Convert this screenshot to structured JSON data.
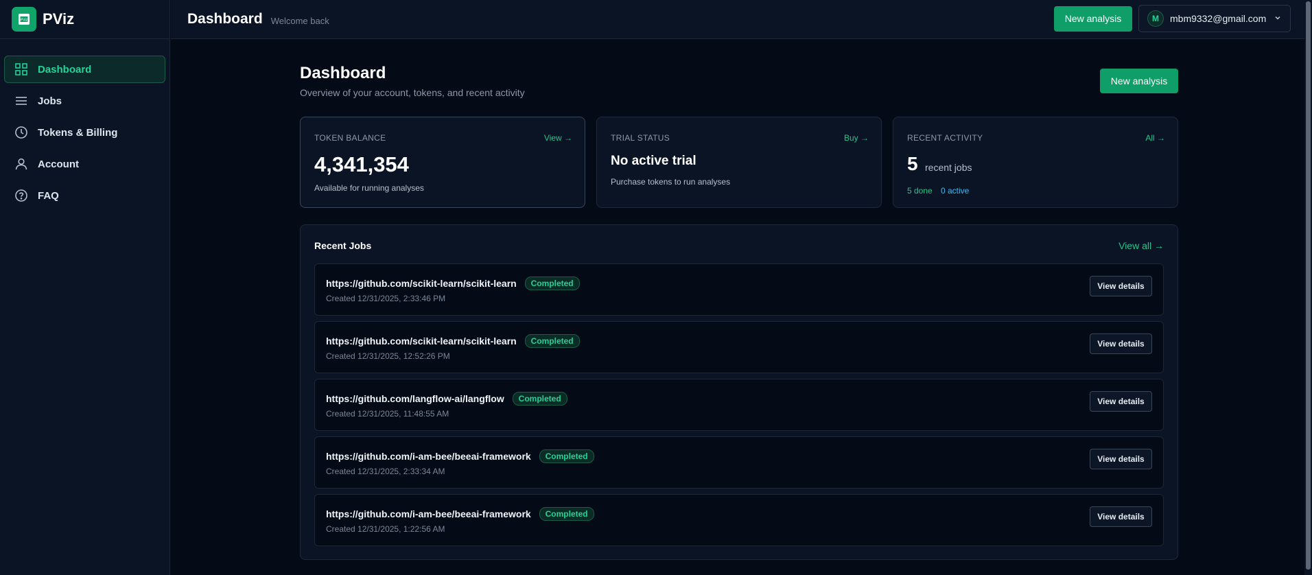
{
  "brand": {
    "name": "PViz",
    "logo_text": "PViz"
  },
  "sidebar": {
    "items": [
      {
        "label": "Dashboard",
        "icon": "grid-icon",
        "active": true
      },
      {
        "label": "Jobs",
        "icon": "list-icon",
        "active": false
      },
      {
        "label": "Tokens & Billing",
        "icon": "clock-icon",
        "active": false
      },
      {
        "label": "Account",
        "icon": "user-icon",
        "active": false
      },
      {
        "label": "FAQ",
        "icon": "help-circle-icon",
        "active": false
      }
    ]
  },
  "topbar": {
    "title": "Dashboard",
    "subtitle": "Welcome back",
    "new_analysis_label": "New analysis",
    "user": {
      "initial": "M",
      "email": "mbm9332@gmail.com"
    }
  },
  "page": {
    "title": "Dashboard",
    "subtitle": "Overview of your account, tokens, and recent activity",
    "new_analysis_label": "New analysis"
  },
  "cards": {
    "token_balance": {
      "label": "TOKEN BALANCE",
      "link": "View →",
      "value": "4,341,354",
      "note": "Available for running analyses"
    },
    "trial_status": {
      "label": "TRIAL STATUS",
      "link": "Buy →",
      "heading": "No active trial",
      "note": "Purchase tokens to run analyses"
    },
    "recent_activity": {
      "label": "RECENT ACTIVITY",
      "link": "All →",
      "count": "5",
      "count_label": "recent jobs",
      "done": "5 done",
      "active": "0 active"
    }
  },
  "recent_jobs": {
    "title": "Recent Jobs",
    "view_all": "View all →",
    "details_label": "View details",
    "jobs": [
      {
        "url": "https://github.com/scikit-learn/scikit-learn",
        "status": "Completed",
        "created": "Created 12/31/2025, 2:33:46 PM"
      },
      {
        "url": "https://github.com/scikit-learn/scikit-learn",
        "status": "Completed",
        "created": "Created 12/31/2025, 12:52:26 PM"
      },
      {
        "url": "https://github.com/langflow-ai/langflow",
        "status": "Completed",
        "created": "Created 12/31/2025, 11:48:55 AM"
      },
      {
        "url": "https://github.com/i-am-bee/beeai-framework",
        "status": "Completed",
        "created": "Created 12/31/2025, 2:33:34 AM"
      },
      {
        "url": "https://github.com/i-am-bee/beeai-framework",
        "status": "Completed",
        "created": "Created 12/31/2025, 1:22:56 AM"
      }
    ]
  },
  "colors": {
    "accent": "#0f9e68",
    "accent_text": "#22d39a",
    "background": "#050a17",
    "panel": "#0b1424",
    "info": "#43b7f0"
  }
}
